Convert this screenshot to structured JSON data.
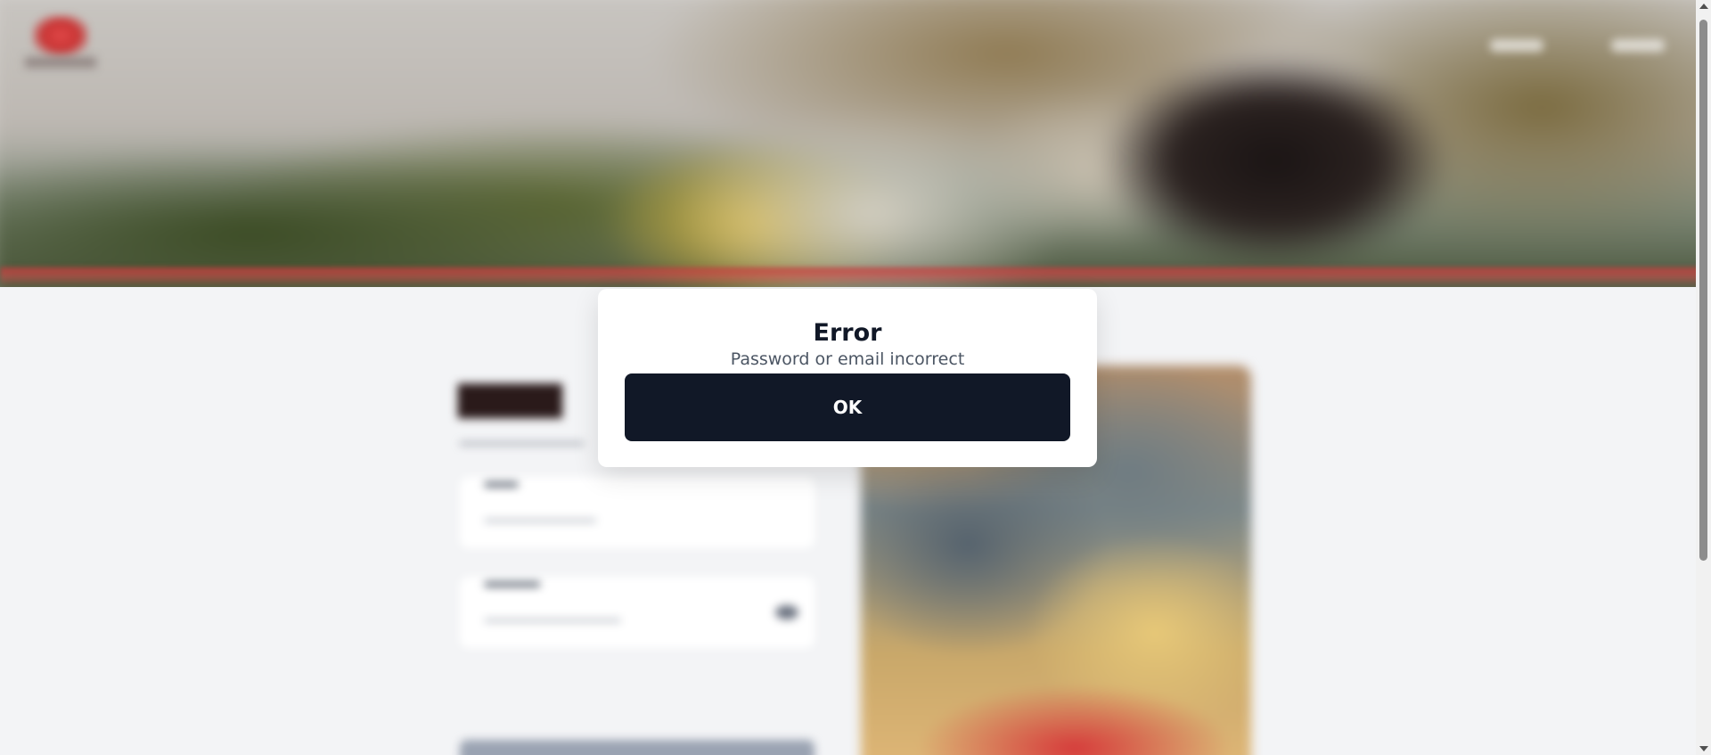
{
  "dialog": {
    "title": "Error",
    "message": "Password or email incorrect",
    "ok_label": "OK"
  },
  "colors": {
    "modal_background": "#ffffff",
    "ok_button": "#111827",
    "page_background": "#f3f4f6",
    "accent_red": "#c83434"
  }
}
